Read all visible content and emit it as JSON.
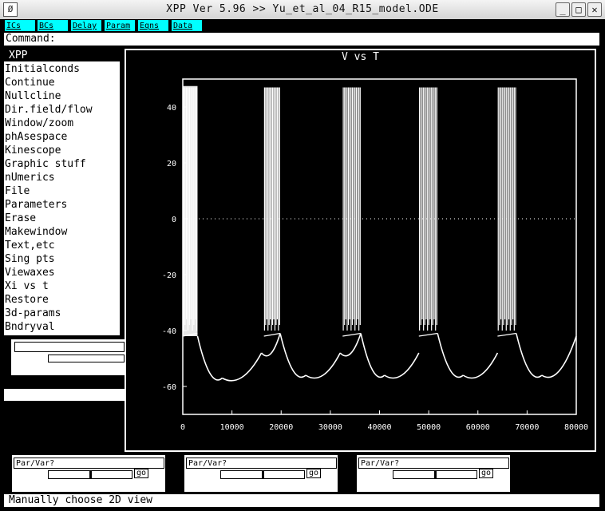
{
  "window": {
    "title": "XPP Ver 5.96 >> Yu_et_al_04_R15_model.ODE",
    "icon_label": "Ø",
    "minimize_label": "_",
    "maximize_label": "□",
    "close_label": "✕"
  },
  "toolbar": {
    "buttons": [
      "ICs",
      "BCs",
      "Delay",
      "Param",
      "Eqns",
      "Data"
    ]
  },
  "command": {
    "label": "Command:"
  },
  "menu": {
    "title": "XPP",
    "items": [
      "Initialconds",
      "Continue",
      "Nullcline",
      "Dir.field/flow",
      "Window/zoom",
      "phAsespace",
      "Kinescope",
      "Graphic stuff",
      "nUmerics",
      "File",
      "Parameters",
      "Erase",
      "Makewindow",
      "Text,etc",
      "Sing pts",
      "Viewaxes",
      "Xi vs t",
      "Restore",
      "3d-params",
      "Bndryval"
    ]
  },
  "par_panels": [
    {
      "label": "Par/Var?",
      "go_label": "go",
      "slider_fraction": 0.5
    },
    {
      "label": "Par/Var?",
      "go_label": "go",
      "slider_fraction": 0.5
    },
    {
      "label": "Par/Var?",
      "go_label": "go",
      "slider_fraction": 0.5
    }
  ],
  "status": {
    "text": "Manually choose 2D view"
  },
  "colors": {
    "accent": "#00ffff",
    "background": "#000000",
    "panel": "#ffffff"
  },
  "chart_data": {
    "type": "line",
    "title": "V vs T",
    "xlabel": "",
    "ylabel": "",
    "xlim": [
      0,
      80000
    ],
    "ylim": [
      -70,
      50
    ],
    "x_ticks": [
      0,
      10000,
      20000,
      30000,
      40000,
      50000,
      60000,
      70000,
      80000
    ],
    "y_ticks": [
      -60,
      -40,
      -20,
      0,
      20,
      40
    ],
    "zero_line": "dotted",
    "grid": false,
    "series": [
      {
        "name": "",
        "description_points": {
          "burst_intervals": [
            [
              0,
              3000
            ],
            [
              16500,
              19800
            ],
            [
              32500,
              36200
            ],
            [
              48000,
              51800
            ],
            [
              64000,
              67800
            ]
          ],
          "spike_peak": 47,
          "spike_trough": -40,
          "trough_points": [
            [
              3000,
              -42
            ],
            [
              8000,
              -57
            ],
            [
              16000,
              -48
            ],
            [
              19800,
              -41
            ],
            [
              25000,
              -56
            ],
            [
              32000,
              -48
            ],
            [
              36200,
              -41
            ],
            [
              41000,
              -56
            ],
            [
              48000,
              -48
            ],
            [
              51800,
              -41
            ],
            [
              57000,
              -56
            ],
            [
              64000,
              -48
            ],
            [
              67800,
              -41
            ],
            [
              73000,
              -56
            ],
            [
              80000,
              -42
            ]
          ]
        }
      }
    ]
  }
}
